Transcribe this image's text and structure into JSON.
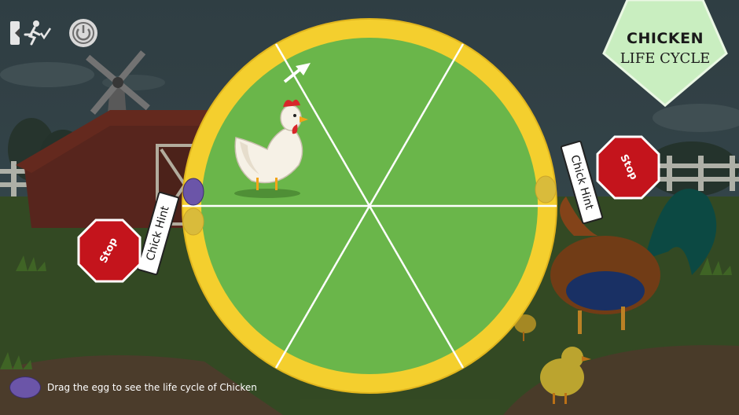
{
  "title": {
    "line1": "CHICKEN",
    "line2": "LIFE CYCLE"
  },
  "toolbar": {
    "exit_icon": "exit-running-icon",
    "power_icon": "power-icon"
  },
  "hints": {
    "left_label": "Chick Hint",
    "right_label": "Chick Hint"
  },
  "stop_signs": {
    "left_label": "Stop",
    "right_label": "Stop"
  },
  "instruction": {
    "text": "Drag the egg to see the life cycle of Chicken"
  },
  "wheel": {
    "segments": 6,
    "filled_segments": 1,
    "current_stage_icon": "hen-icon"
  },
  "colors": {
    "wheel_green": "#6ab64a",
    "wheel_rim": "#f4cf2e",
    "egg_purple": "#6b55a8",
    "stop_red": "#c4141c",
    "badge_green": "#c9eec0"
  }
}
